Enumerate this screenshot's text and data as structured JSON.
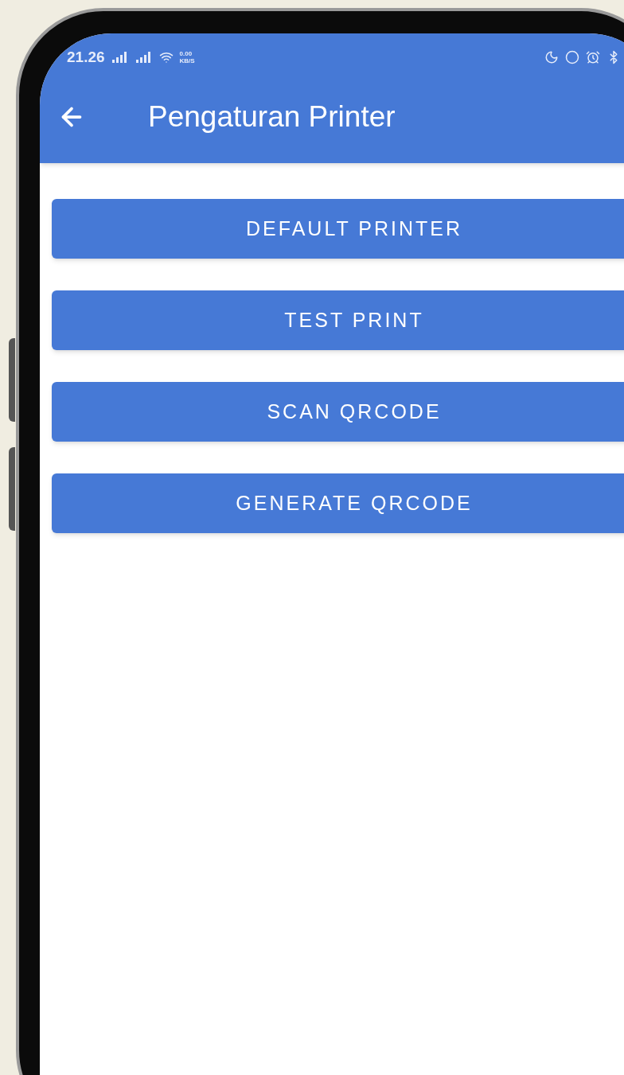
{
  "status_bar": {
    "time": "21.26",
    "speed": [
      "0.00",
      "KB/S"
    ]
  },
  "app_bar": {
    "title": "Pengaturan Printer"
  },
  "buttons": [
    {
      "label": "DEFAULT PRINTER"
    },
    {
      "label": "TEST PRINT"
    },
    {
      "label": "SCAN QRCODE"
    },
    {
      "label": "GENERATE QRCODE"
    }
  ]
}
